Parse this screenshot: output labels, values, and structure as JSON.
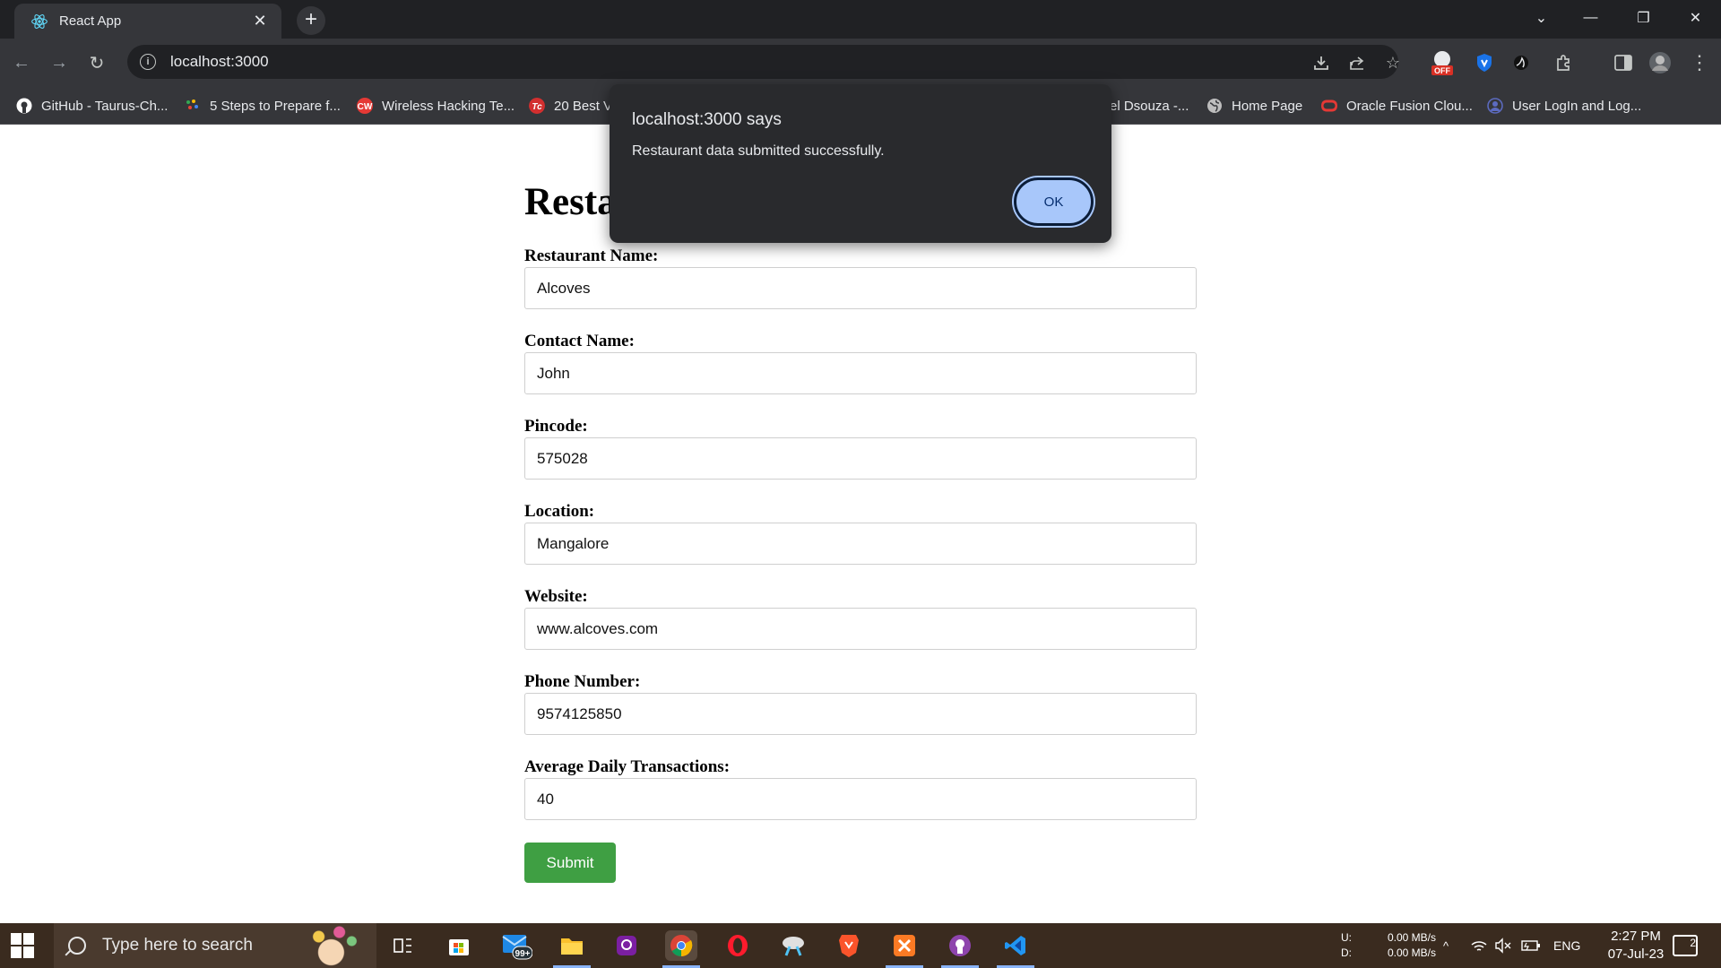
{
  "browser": {
    "tab_title": "React App",
    "tab_close": "✕",
    "new_tab": "+",
    "url": "localhost:3000",
    "window_controls": {
      "tab_search": "⌄",
      "minimize": "—",
      "restore": "❐",
      "close": "✕"
    },
    "toolbar_icons": [
      "download-icon",
      "share-icon",
      "bookmark-star-icon",
      "extension-off-icon",
      "shield-extension-icon",
      "dark-extension-icon",
      "puzzle-icon",
      "sidebar-icon",
      "profile-avatar",
      "menu-icon"
    ],
    "off_badge": "OFF"
  },
  "bookmarks": [
    {
      "label": "GitHub - Taurus-Ch...",
      "icon": "github-icon",
      "color": "#ffffff"
    },
    {
      "label": "5 Steps to Prepare f...",
      "icon": "dots-icon",
      "color": "#34a853"
    },
    {
      "label": "Wireless Hacking Te...",
      "icon": "cw-icon",
      "color": "#e53935"
    },
    {
      "label": "20 Best V",
      "icon": "tc-icon",
      "color": "#d32f2f"
    },
    {
      "label": "el Dsouza -...",
      "icon": "",
      "color": ""
    },
    {
      "label": "Home Page",
      "icon": "globe-icon",
      "color": "#bdbdbd"
    },
    {
      "label": "Oracle Fusion Clou...",
      "icon": "oracle-icon",
      "color": "#e53935"
    },
    {
      "label": "User LogIn and Log...",
      "icon": "user-icon",
      "color": "#5c6bc0"
    }
  ],
  "page": {
    "heading": "Resta",
    "fields": [
      {
        "label": "Restaurant Name:",
        "value": "Alcoves"
      },
      {
        "label": "Contact Name:",
        "value": "John"
      },
      {
        "label": "Pincode:",
        "value": "575028"
      },
      {
        "label": "Location:",
        "value": "Mangalore"
      },
      {
        "label": "Website:",
        "value": "www.alcoves.com"
      },
      {
        "label": "Phone Number:",
        "value": "9574125850"
      },
      {
        "label": "Average Daily Transactions:",
        "value": "40"
      }
    ],
    "submit_label": "Submit"
  },
  "dialog": {
    "title": "localhost:3000 says",
    "message": "Restaurant data submitted successfully.",
    "ok_label": "OK"
  },
  "taskbar": {
    "search_placeholder": "Type here to search",
    "mail_badge": "99+",
    "net_upload_label": "U:",
    "net_download_label": "D:",
    "net_upload": "0.00 MB/s",
    "net_download": "0.00 MB/s",
    "language": "ENG",
    "time": "2:27 PM",
    "date": "07-Jul-23",
    "notification_count": "2"
  }
}
